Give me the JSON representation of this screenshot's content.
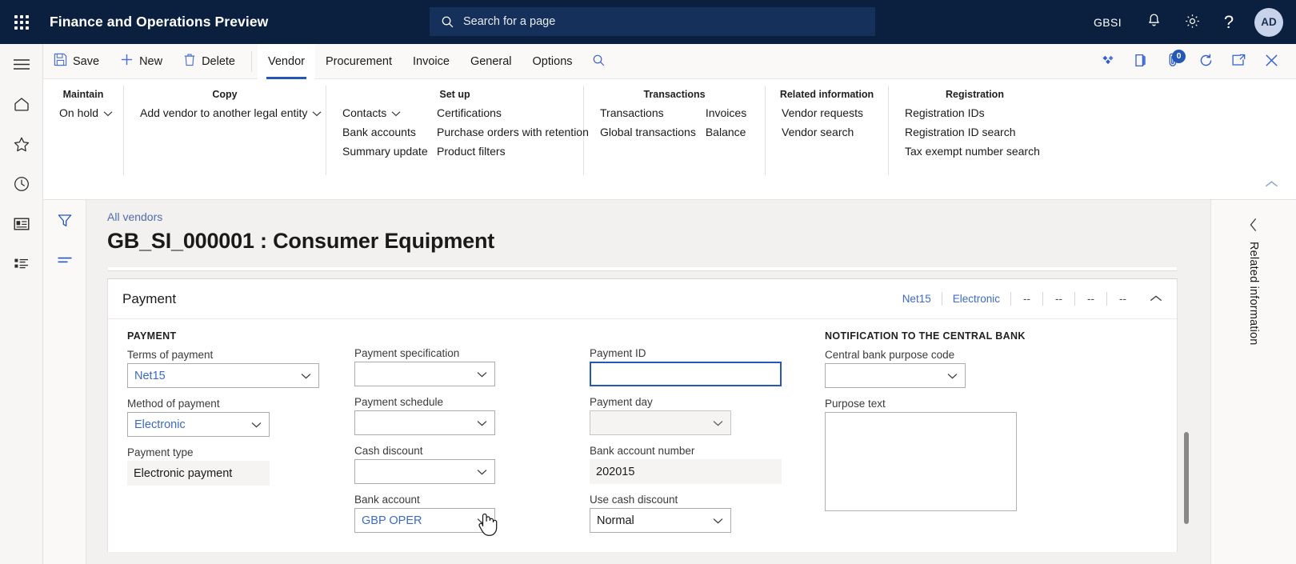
{
  "topbar": {
    "waffle_label": "App launcher",
    "app_title": "Finance and Operations Preview",
    "search_placeholder": "Search for a page",
    "company": "GBSI",
    "notifications_icon": "bell-icon",
    "settings_icon": "gear-icon",
    "help_icon": "question-icon",
    "avatar_initials": "AD"
  },
  "leftrail": {
    "items": [
      {
        "name": "hamburger-icon",
        "label": "Expand the navigation pane"
      },
      {
        "name": "home-icon",
        "label": "Home"
      },
      {
        "name": "star-icon",
        "label": "Favorites"
      },
      {
        "name": "clock-icon",
        "label": "Recent"
      },
      {
        "name": "workspaces-icon",
        "label": "Workspaces"
      },
      {
        "name": "modules-icon",
        "label": "Modules"
      }
    ]
  },
  "formrail": {
    "items": [
      {
        "name": "filter-icon",
        "label": "Show filters"
      },
      {
        "name": "summary-icon",
        "label": "Quick filter"
      }
    ]
  },
  "commandbar": {
    "save_label": "Save",
    "new_label": "New",
    "delete_label": "Delete",
    "tabs": [
      {
        "label": "Vendor",
        "active": true
      },
      {
        "label": "Procurement",
        "active": false
      },
      {
        "label": "Invoice",
        "active": false
      },
      {
        "label": "General",
        "active": false
      },
      {
        "label": "Options",
        "active": false
      }
    ],
    "search_icon": "search-icon",
    "right_icons": [
      {
        "name": "office-addin-icon"
      },
      {
        "name": "open-in-office-icon"
      },
      {
        "name": "attachment-icon",
        "badge": "0"
      },
      {
        "name": "refresh-icon"
      },
      {
        "name": "popout-icon"
      },
      {
        "name": "close-icon"
      }
    ]
  },
  "ribbon": {
    "collapse_icon": "chevron-up-icon",
    "groups": [
      {
        "header": "Maintain",
        "columns": [
          {
            "links": [
              {
                "label": "On hold",
                "dropdown": true
              }
            ]
          }
        ]
      },
      {
        "header": "Copy",
        "columns": [
          {
            "links": [
              {
                "label": "Add vendor to another legal entity",
                "dropdown": true
              }
            ]
          }
        ]
      },
      {
        "header": "Set up",
        "columns": [
          {
            "links": [
              {
                "label": "Contacts",
                "dropdown": true
              },
              {
                "label": "Bank accounts",
                "dropdown": false
              },
              {
                "label": "Summary update",
                "dropdown": false
              }
            ]
          },
          {
            "links": [
              {
                "label": "Certifications",
                "dropdown": false
              },
              {
                "label": "Purchase orders with retention",
                "dropdown": false
              },
              {
                "label": "Product filters",
                "dropdown": false
              }
            ]
          }
        ]
      },
      {
        "header": "Transactions",
        "columns": [
          {
            "links": [
              {
                "label": "Transactions",
                "dropdown": false
              },
              {
                "label": "Global transactions",
                "dropdown": false
              }
            ]
          },
          {
            "links": [
              {
                "label": "Invoices",
                "dropdown": false
              },
              {
                "label": "Balance",
                "dropdown": false
              }
            ]
          }
        ]
      },
      {
        "header": "Related information",
        "columns": [
          {
            "links": [
              {
                "label": "Vendor requests",
                "dropdown": false
              },
              {
                "label": "Vendor search",
                "dropdown": false
              }
            ]
          }
        ]
      },
      {
        "header": "Registration",
        "columns": [
          {
            "links": [
              {
                "label": "Registration IDs",
                "dropdown": false
              },
              {
                "label": "Registration ID search",
                "dropdown": false
              },
              {
                "label": "Tax exempt number search",
                "dropdown": false
              }
            ]
          }
        ]
      }
    ]
  },
  "page": {
    "breadcrumb": "All vendors",
    "title": "GB_SI_000001 : Consumer Equipment"
  },
  "card": {
    "title": "Payment",
    "summary": [
      {
        "text": "Net15",
        "link": true
      },
      {
        "text": "Electronic",
        "link": true
      },
      {
        "text": "--",
        "link": false
      },
      {
        "text": "--",
        "link": false
      },
      {
        "text": "--",
        "link": false
      },
      {
        "text": "--",
        "link": false
      }
    ],
    "collapse_icon": "chevron-up-icon"
  },
  "form": {
    "group_payment": "PAYMENT",
    "group_central_bank": "NOTIFICATION TO THE CENTRAL BANK",
    "terms_of_payment": {
      "label": "Terms of payment",
      "value": "Net15"
    },
    "method_of_payment": {
      "label": "Method of payment",
      "value": "Electronic"
    },
    "payment_type": {
      "label": "Payment type",
      "value": "Electronic payment"
    },
    "payment_specification": {
      "label": "Payment specification",
      "value": ""
    },
    "payment_schedule": {
      "label": "Payment schedule",
      "value": ""
    },
    "cash_discount": {
      "label": "Cash discount",
      "value": ""
    },
    "bank_account": {
      "label": "Bank account",
      "value": "GBP OPER"
    },
    "payment_id": {
      "label": "Payment ID",
      "value": ""
    },
    "payment_day": {
      "label": "Payment day",
      "value": ""
    },
    "bank_account_number": {
      "label": "Bank account number",
      "value": "202015"
    },
    "use_cash_discount": {
      "label": "Use cash discount",
      "value": "Normal"
    },
    "central_bank_purpose_code": {
      "label": "Central bank purpose code",
      "value": ""
    },
    "purpose_text": {
      "label": "Purpose text",
      "value": ""
    }
  },
  "rightpane": {
    "collapse_icon": "chevron-left-icon",
    "label": "Related information"
  }
}
